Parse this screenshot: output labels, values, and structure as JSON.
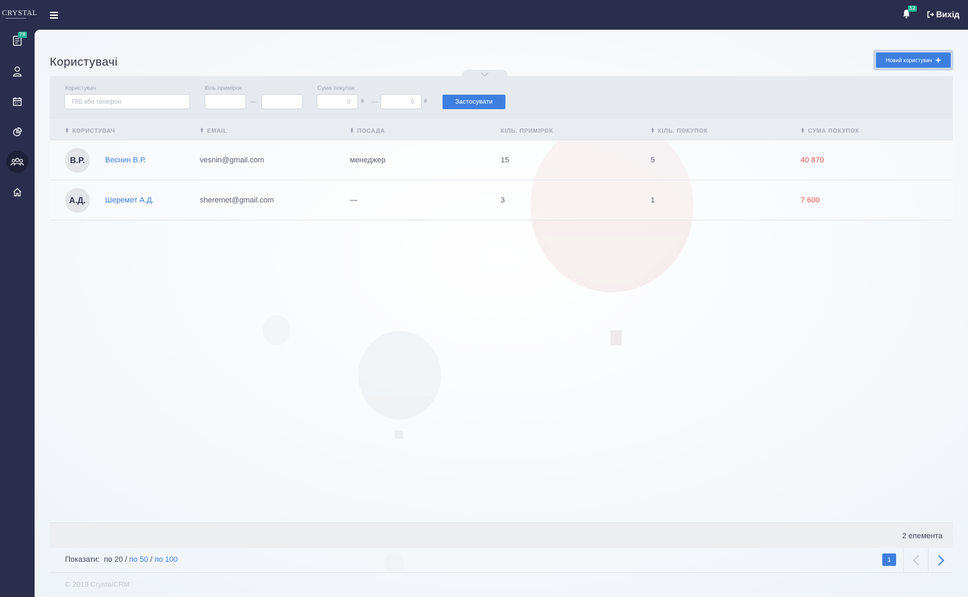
{
  "app": {
    "logo": "CRYSTAL",
    "notifications_count": "52",
    "logout_label": "Вихід"
  },
  "sidebar": {
    "items": [
      {
        "name": "orders",
        "icon": "receipt-icon",
        "badge": "78"
      },
      {
        "name": "clients",
        "icon": "user-icon"
      },
      {
        "name": "calendar",
        "icon": "calendar-icon"
      },
      {
        "name": "reports",
        "icon": "pie-chart-icon"
      },
      {
        "name": "users",
        "icon": "users-icon",
        "active": true
      },
      {
        "name": "home",
        "icon": "home-icon"
      }
    ]
  },
  "page": {
    "title": "Користувачі",
    "new_user_button": "Новий користувач"
  },
  "filters": {
    "user_label": "Користувач",
    "user_placeholder": "ПІБ або телефон",
    "fittings_label": "Кіль.примірок",
    "fittings_from": "",
    "fittings_to": "",
    "range_dash": "—",
    "purchases_sum_label": "Сума покупок",
    "sum_from": "0",
    "sum_to": "0",
    "currency": "₴",
    "apply_button": "Застосувати"
  },
  "table": {
    "columns": {
      "user": "КОРИСТУВАЧ",
      "email": "EMAIL",
      "position": "ПОСАДА",
      "fittings": "КІЛЬ. ПРИМІРОК",
      "purchases": "КІЛЬ. ПОКУПОК",
      "sum": "СУМА ПОКУПОК"
    },
    "rows": [
      {
        "initials": "В.Р.",
        "name": "Веснин В.Р.",
        "email": "vesnin@gmail.com",
        "position": "менеджер",
        "fittings": "15",
        "purchases": "5",
        "sum": "40 870"
      },
      {
        "initials": "А.Д.",
        "name": "Шеремет А.Д.",
        "email": "sheremet@gmail.com",
        "position": "—",
        "fittings": "3",
        "purchases": "1",
        "sum": "7 600"
      }
    ]
  },
  "pagination": {
    "total": "2 елемента",
    "show_label": "Показати:",
    "per_20": "по 20",
    "per_50": "по 50",
    "per_100": "по 100",
    "separator": "/",
    "current_page": "1"
  },
  "footer": {
    "copyright": "© 2019 CrystalCRM"
  },
  "colors": {
    "sidebar_bg": "#2a2d4c",
    "accent": "#3d7fe0",
    "badge": "#1fb39a",
    "amount_red": "#e8524e"
  }
}
